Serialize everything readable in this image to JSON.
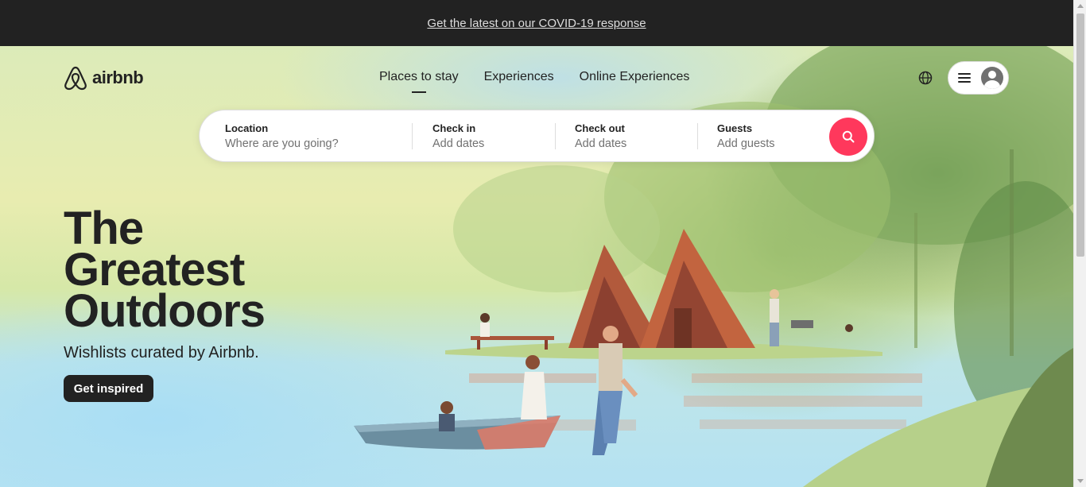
{
  "banner": {
    "link_text": "Get the latest on our COVID-19 response"
  },
  "header": {
    "logo_text": "airbnb",
    "nav": [
      {
        "label": "Places to stay",
        "active": true
      },
      {
        "label": "Experiences",
        "active": false
      },
      {
        "label": "Online Experiences",
        "active": false
      }
    ],
    "icons": {
      "language": "globe-icon",
      "menu": "hamburger-icon",
      "profile": "avatar-icon"
    }
  },
  "search": {
    "location": {
      "label": "Location",
      "placeholder": "Where are you going?"
    },
    "check_in": {
      "label": "Check in",
      "placeholder": "Add dates"
    },
    "check_out": {
      "label": "Check out",
      "placeholder": "Add dates"
    },
    "guests": {
      "label": "Guests",
      "placeholder": "Add guests"
    },
    "button_color": "#ff385c",
    "button_icon": "search-icon"
  },
  "hero": {
    "headline_lines": [
      "The",
      "Greatest",
      "Outdoors"
    ],
    "subline": "Wishlists curated by Airbnb.",
    "cta_label": "Get inspired"
  },
  "colors": {
    "accent": "#ff385c",
    "dark": "#222222",
    "banner": "#222222"
  }
}
